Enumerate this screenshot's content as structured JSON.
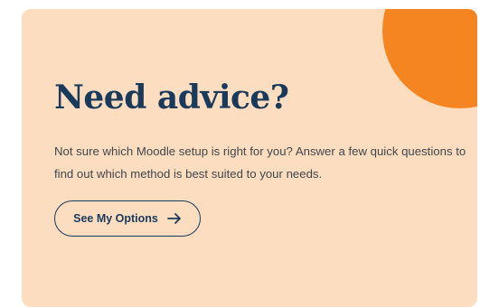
{
  "card": {
    "heading": "Need advice?",
    "description": "Not sure which Moodle setup is right for you? Answer a few quick questions to find out which method is best suited to your needs.",
    "cta": {
      "label": "See My Options",
      "icon": "arrow-right-icon"
    }
  },
  "colors": {
    "card_background": "#fdddbf",
    "accent_circle": "#f58520",
    "heading": "#1a3a5c",
    "body_text": "#40464c"
  }
}
